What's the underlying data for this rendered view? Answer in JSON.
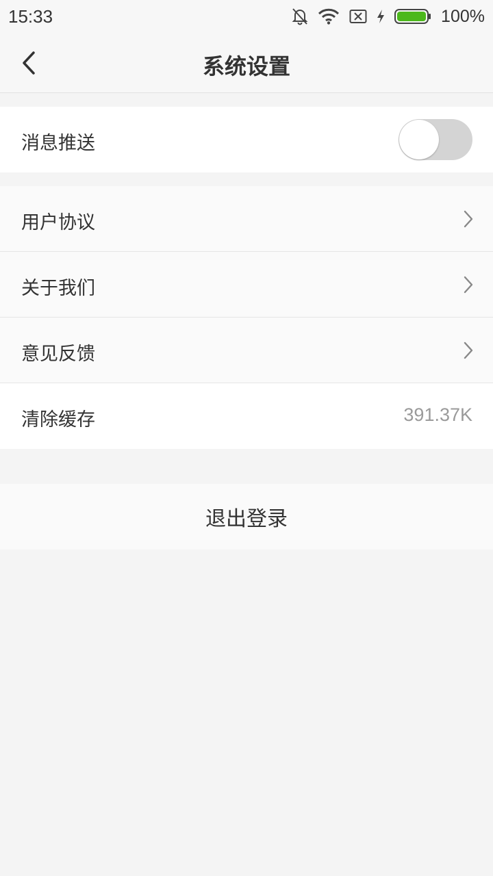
{
  "status_bar": {
    "time": "15:33",
    "battery_percent": "100%",
    "icons": [
      "notifications-off-icon",
      "wifi-icon",
      "sim-blocked-icon",
      "charging-icon",
      "battery-icon"
    ],
    "battery_color": "#4cb81c"
  },
  "header": {
    "title": "系统设置",
    "back_icon": "chevron-left-icon"
  },
  "settings": {
    "push": {
      "label": "消息推送",
      "enabled": false
    },
    "items": [
      {
        "label": "用户协议",
        "icon": "chevron-right-icon"
      },
      {
        "label": "关于我们",
        "icon": "chevron-right-icon"
      },
      {
        "label": "意见反馈",
        "icon": "chevron-right-icon"
      }
    ],
    "cache": {
      "label": "清除缓存",
      "value": "391.37K"
    }
  },
  "logout": {
    "label": "退出登录"
  }
}
